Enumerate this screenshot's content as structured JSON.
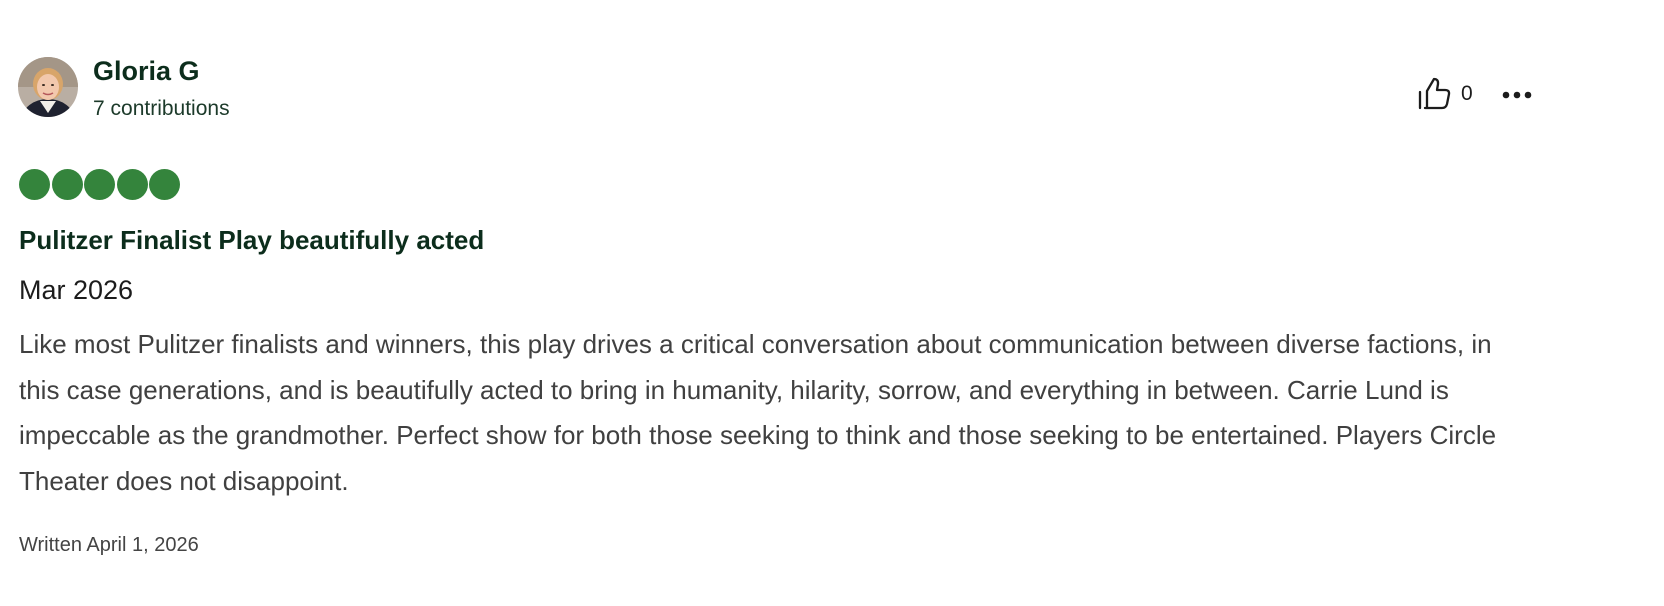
{
  "review": {
    "user_name": "Gloria G",
    "contributions": "7 contributions",
    "like_count": "0",
    "rating": 5,
    "title": "Pulitzer Finalist Play beautifully acted",
    "date": "Mar 2026",
    "body": "Like most Pulitzer finalists and winners, this play drives a critical conversation about communication between diverse factions, in this case generations, and is beautifully acted to bring in humanity, hilarity, sorrow, and everything in between. Carrie Lund is impeccable as the grandmother. Perfect show for both those seeking to think and those seeking to be entertained. Players Circle Theater does not disappoint.",
    "written": "Written April 1, 2026"
  },
  "colors": {
    "rating_green": "#34843c",
    "title_green": "#0c2d1c"
  },
  "icons": {
    "like": "thumbs-up-icon",
    "more": "more-horizontal-icon"
  }
}
